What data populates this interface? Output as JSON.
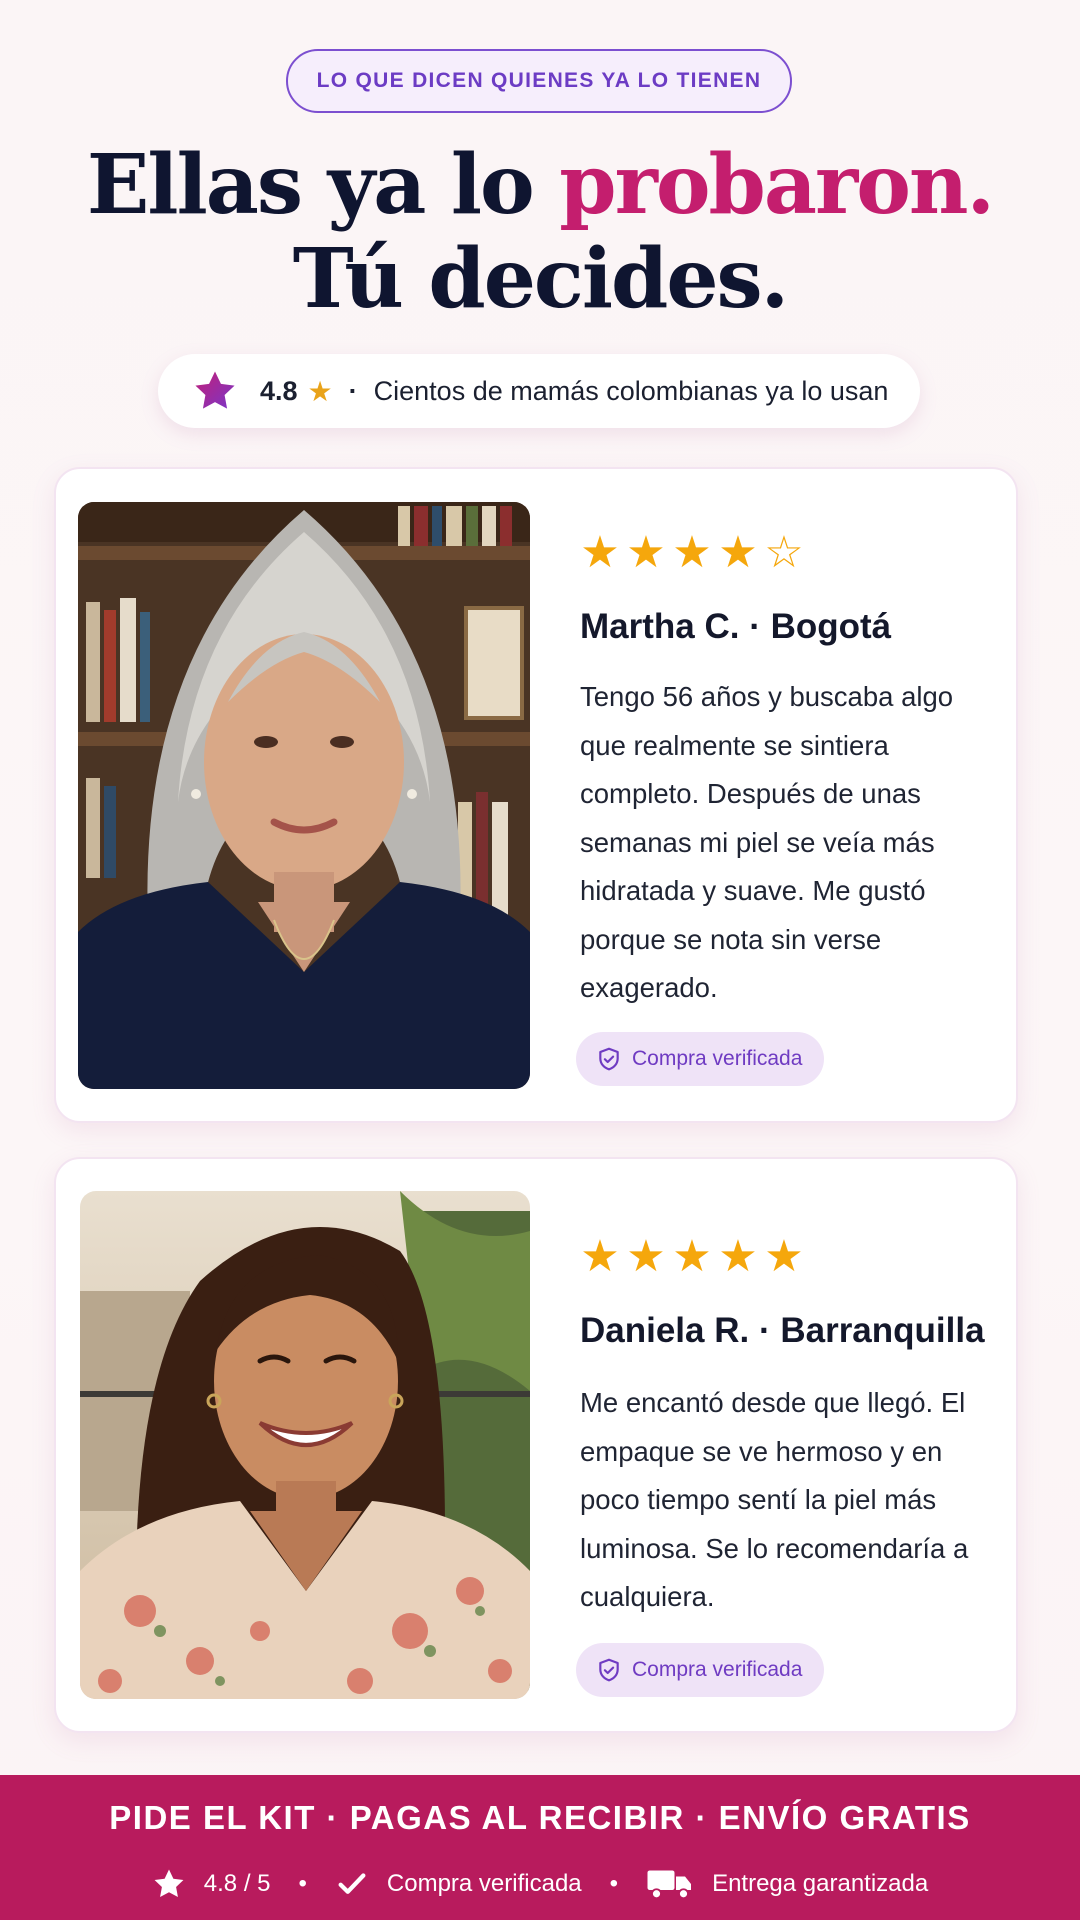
{
  "eyebrow": "LO QUE DICEN QUIENES YA LO TIENEN",
  "headline": {
    "part1": "Ellas ya lo ",
    "accent": "probaron.",
    "line2": "Tú decides."
  },
  "rating_pill": {
    "value": "4.8",
    "separator": "·",
    "text": "Cientos de mamás colombianas ya lo usan"
  },
  "reviews": [
    {
      "stars": 4,
      "max_stars": 5,
      "name": "Martha C. · Bogotá",
      "text": "Tengo 56 años y buscaba algo que realmente se sintiera completo. Después de unas semanas mi piel se veía más hidratada y suave. Me gustó porque se nota sin verse exagerado.",
      "badge": "Compra verificada"
    },
    {
      "stars": 5,
      "max_stars": 5,
      "name": "Daniela R. · Barranquilla",
      "text": "Me encantó desde que llegó. El empaque se ve hermoso y en poco tiempo sentí la piel más luminosa. Se lo recomendaría a cualquiera.",
      "badge": "Compra verificada"
    }
  ],
  "footer": {
    "cta": "PIDE EL KIT · PAGAS AL RECIBIR · ENVÍO GRATIS",
    "rating": "4.8 / 5",
    "verified": "Compra verificada",
    "delivery": "Entrega garantizada",
    "separator": "•"
  },
  "colors": {
    "accent": "#c41e6e",
    "footer_bg": "#b81b5d",
    "star_gold": "#f5a70c",
    "badge_purple": "#6f3bc2"
  }
}
